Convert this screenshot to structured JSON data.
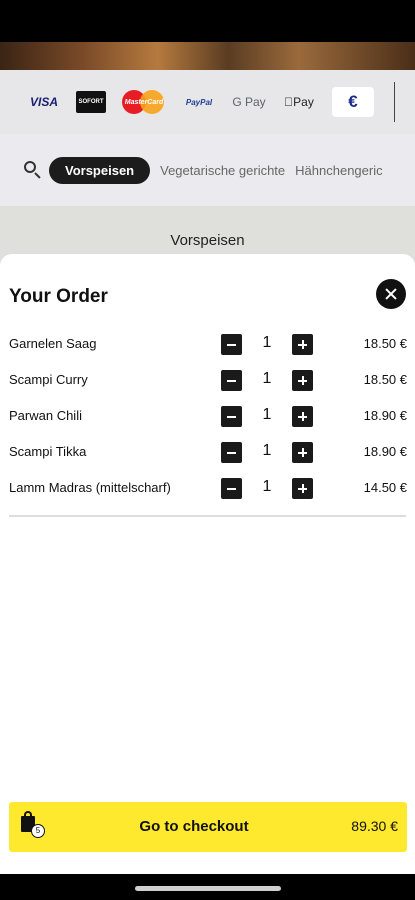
{
  "payments": {
    "methods": [
      {
        "name": "visa",
        "label": "VISA"
      },
      {
        "name": "sofort",
        "label": "SOFORT"
      },
      {
        "name": "mastercard",
        "label": "MasterCard"
      },
      {
        "name": "paypal",
        "label": "PayPal"
      },
      {
        "name": "google-pay",
        "label": "G Pay"
      },
      {
        "name": "apple-pay",
        "label": "Pay"
      },
      {
        "name": "euro",
        "label": "€"
      }
    ]
  },
  "categories": {
    "search_icon": "search-icon",
    "items": [
      "Vorspeisen",
      "Vegetarische gerichte",
      "Hähnchengeric"
    ],
    "active": "Vorspeisen"
  },
  "section": {
    "title": "Vorspeisen"
  },
  "order": {
    "title": "Your Order",
    "close_icon": "close-icon",
    "items": [
      {
        "name": "Garnelen Saag",
        "qty": "1",
        "price": "18.50 €"
      },
      {
        "name": "Scampi Curry",
        "qty": "1",
        "price": "18.50 €"
      },
      {
        "name": "Parwan Chili",
        "qty": "1",
        "price": "18.90 €"
      },
      {
        "name": "Scampi Tikka",
        "qty": "1",
        "price": "18.90 €"
      },
      {
        "name": "Lamm Madras (mittelscharf)",
        "qty": "1",
        "price": "14.50 €"
      }
    ]
  },
  "checkout": {
    "bag_icon": "shopping-bag-icon",
    "item_count": "5",
    "label": "Go to checkout",
    "total": "89.30 €",
    "color": "#ffe92e"
  }
}
